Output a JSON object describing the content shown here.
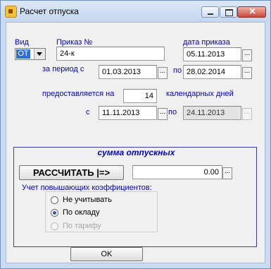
{
  "window": {
    "title": "Расчет отпуска"
  },
  "order": {
    "type_label": "Вид",
    "type_value": "ОТ",
    "number_label": "Приказ №",
    "number_value": "24-к",
    "date_label": "дата приказа",
    "date_value": "05.11.2013"
  },
  "period": {
    "label_from": "за период с",
    "from_value": "01.03.2013",
    "label_to": "по",
    "to_value": "28.02.2014"
  },
  "vacation": {
    "label_pre": "предоставляется на",
    "days_value": "14",
    "label_post": "календарных дней",
    "label_from": "с",
    "from_value": "11.11.2013",
    "label_to": "по",
    "to_value": "24.11.2013"
  },
  "dots_label": "...",
  "pay": {
    "title": "сумма отпускных",
    "calc_label": "РАССЧИТАТЬ |=>",
    "amount_value": "0.00",
    "coeff_label": "Учет повышающих коэффициентов:",
    "options": [
      {
        "label": "Не учитывать",
        "selected": false,
        "disabled": false
      },
      {
        "label": "По окладу",
        "selected": true,
        "disabled": false
      },
      {
        "label": "По тарифу",
        "selected": false,
        "disabled": true
      }
    ]
  },
  "ok_label": "OK",
  "colors": {
    "label_blue": "#0000d0",
    "title_bg": "#cbdcf2",
    "close_red": "#c9473b"
  }
}
